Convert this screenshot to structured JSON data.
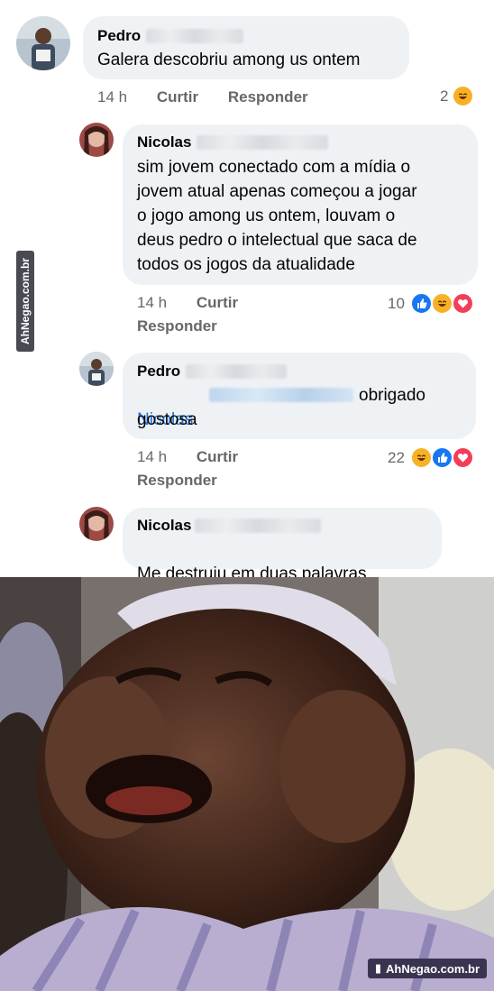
{
  "comments": [
    {
      "author": "Pedro",
      "text": "Galera descobriu among us ontem",
      "time": "14 h",
      "like": "Curtir",
      "reply": "Responder",
      "reaction_count": "2"
    },
    {
      "author": "Nicolas",
      "text": "sim jovem conectado com a mídia o\njovem atual apenas começou a jogar\no jogo among us ontem, louvam o\ndeus pedro o intelectual que saca de\ntodos os jogos da atualidade",
      "time": "14 h",
      "like": "Curtir",
      "reply": "Responder",
      "reaction_count": "10"
    },
    {
      "author": "Pedro",
      "mention": "Nicolas",
      "text_after_mention": "obrigado",
      "text_line2": "gostosa",
      "time": "14 h",
      "like": "Curtir",
      "reply": "Responder",
      "reaction_count": "22"
    },
    {
      "author": "Nicolas",
      "text": "Me destruiu em duas palavras",
      "emoji": "😔"
    }
  ],
  "watermark": {
    "side": "AhNegao.com.br",
    "bottom": "AhNegao.com.br"
  },
  "colors": {
    "bubble": "#eff2f5",
    "link": "#216fdb",
    "meta": "#65676b",
    "like": "#1877f2",
    "haha": "#f7b125",
    "love": "#f33e58"
  }
}
